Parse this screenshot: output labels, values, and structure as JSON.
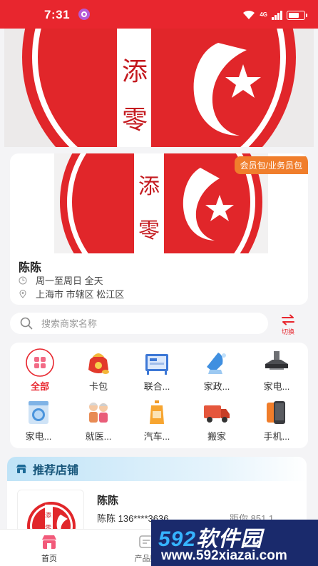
{
  "status_bar": {
    "time": "7:31",
    "network": "4G"
  },
  "store_card": {
    "tag": "会员包/业务员包",
    "name": "陈陈",
    "hours": "周一至周日 全天",
    "address": "上海市 市辖区 松江区",
    "logo_text_1": "添",
    "logo_text_2": "零"
  },
  "banner": {
    "logo_text_1": "添",
    "logo_text_2": "零"
  },
  "search": {
    "placeholder": "搜索商家名称",
    "switch_label": "切换"
  },
  "categories": [
    {
      "label": "全部",
      "icon": "grid-icon"
    },
    {
      "label": "卡包",
      "icon": "gift-bag-icon"
    },
    {
      "label": "联合...",
      "icon": "office-icon"
    },
    {
      "label": "家政...",
      "icon": "cleaning-icon"
    },
    {
      "label": "家电...",
      "icon": "range-hood-icon"
    },
    {
      "label": "家电...",
      "icon": "washing-machine-icon"
    },
    {
      "label": "就医...",
      "icon": "elderly-icon"
    },
    {
      "label": "汽车...",
      "icon": "car-care-icon"
    },
    {
      "label": "搬家",
      "icon": "truck-icon"
    },
    {
      "label": "手机...",
      "icon": "phone-icon"
    }
  ],
  "recommend": {
    "title": "推荐店铺",
    "item": {
      "name": "陈陈",
      "phone": "陈陈 136****3636",
      "distance": "距你 851.1"
    }
  },
  "tabbar": {
    "home": "首页",
    "products": "产品购"
  },
  "watermark": {
    "brand_num": "592",
    "brand_text": "软件园",
    "url": "www.592xiazai.com"
  },
  "colors": {
    "primary": "#e8262e",
    "tag": "#f07e2c",
    "rec_header": "#bfe3f7"
  }
}
